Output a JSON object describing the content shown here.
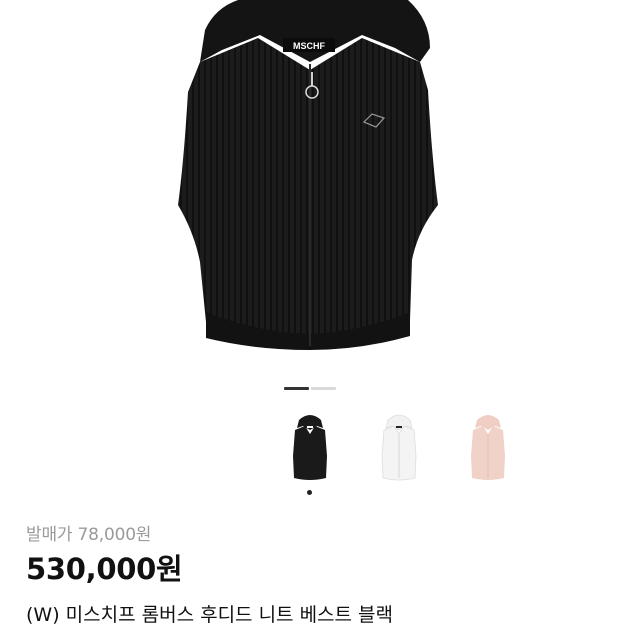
{
  "product": {
    "brand_label": "MSCHF",
    "original_price": "발매가 78,000원",
    "sale_price": "530,000원",
    "name": "(W) 미스치프 롬버스 후디드 니트 베스트 블랙"
  },
  "gallery": {
    "current_page": 1,
    "total_pages": 2
  },
  "variants": [
    {
      "color_name": "black",
      "color": "#1a1a1a",
      "selected": true
    },
    {
      "color_name": "white",
      "color": "#f2f2f2",
      "selected": false
    },
    {
      "color_name": "pink",
      "color": "#f0d2c8",
      "selected": false
    }
  ]
}
